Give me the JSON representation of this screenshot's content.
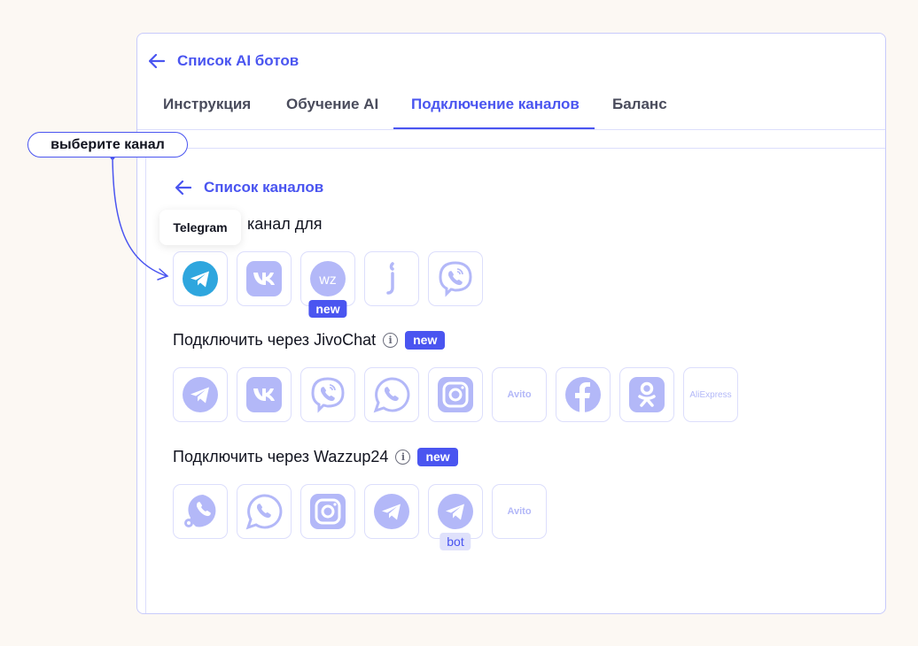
{
  "header": {
    "back_label": "Список AI ботов"
  },
  "tabs": [
    {
      "label": "Инструкция"
    },
    {
      "label": "Обучение AI"
    },
    {
      "label": "Подключение каналов",
      "active": true
    },
    {
      "label": "Баланс"
    }
  ],
  "annotation": {
    "label": "выберите канал"
  },
  "panel": {
    "back_label": "Список каналов",
    "heading_visible": "канал для",
    "tooltip": "Telegram",
    "colors": {
      "accent": "#4a55f0",
      "icon": "#b3b8f8",
      "telegram": "#2ea6de"
    },
    "sections": [
      {
        "title": null,
        "items": [
          {
            "icon": "telegram",
            "active": true
          },
          {
            "icon": "vk"
          },
          {
            "icon": "wz",
            "badge": "new",
            "text": "WZ"
          },
          {
            "icon": "jivo"
          },
          {
            "icon": "viber"
          }
        ]
      },
      {
        "title": "Подключить через JivoChat",
        "badge": "new",
        "items": [
          {
            "icon": "telegram"
          },
          {
            "icon": "vk"
          },
          {
            "icon": "viber"
          },
          {
            "icon": "whatsapp"
          },
          {
            "icon": "instagram"
          },
          {
            "icon": "avito",
            "text": "Avito"
          },
          {
            "icon": "facebook"
          },
          {
            "icon": "odnoklassniki"
          },
          {
            "icon": "aliexpress",
            "text": "AliExpress"
          }
        ]
      },
      {
        "title": "Подключить через Wazzup24",
        "badge": "new",
        "items": [
          {
            "icon": "whatsapp-business"
          },
          {
            "icon": "whatsapp"
          },
          {
            "icon": "instagram"
          },
          {
            "icon": "telegram"
          },
          {
            "icon": "telegram",
            "badge": "bot",
            "badge_kind": "bot"
          },
          {
            "icon": "avito",
            "text": "Avito"
          }
        ]
      }
    ]
  }
}
